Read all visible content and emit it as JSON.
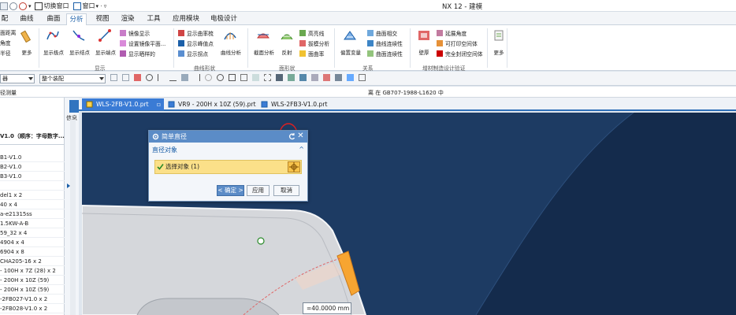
{
  "quick_access": {
    "switch_window": "切换窗口",
    "window": "窗口"
  },
  "app": {
    "title": "NX 12 - 建模"
  },
  "ribbon_tabs": [
    "配",
    "曲线",
    "曲面",
    "分析",
    "视图",
    "渲染",
    "工具",
    "应用模块",
    "电极设计"
  ],
  "ribbon": {
    "g0_small": [
      "面距离",
      "角度",
      "半径"
    ],
    "g0_more": "更多",
    "g1_big": [
      "显示极点",
      "显示结点",
      "显示端点"
    ],
    "g1_small": [
      "镜像显示",
      "设置镜像平面...",
      "显示晒样的"
    ],
    "g1_label": "显示",
    "g2_small": [
      "显示曲率梳",
      "显示峰值点",
      "显示拐点"
    ],
    "g2_big": "曲线分析",
    "g2_label": "曲线形状",
    "g3_big": [
      "截面分析",
      "反射"
    ],
    "g3_small": [
      "高亮线",
      "拔模分析",
      "面曲率"
    ],
    "g3_label": "面形状",
    "g4_big": "偏置变量",
    "g4_small": [
      "曲面相交",
      "曲线连续性",
      "曲面连续性"
    ],
    "g4_label": "关系",
    "g5_big": "壁厚",
    "g5_small": [
      "延展角度",
      "可打印空间体",
      "完全封闭空间体"
    ],
    "g5_label": "增材制造设计验证",
    "g6_more": "更多"
  },
  "toolbar": {
    "filter_value": "器",
    "assembly_value": "整个装配"
  },
  "status": {
    "left_label": "径测量",
    "message": "离 在 GB707-1988-L1620 中"
  },
  "navigator": {
    "side_label": "信息",
    "column_header": "V1.0（顺序：字母数字...",
    "items": [
      "B1-V1.0",
      "B2-V1.0",
      "B3-V1.0",
      "",
      "del1 x 2",
      "40 x 4",
      "a-e21315ss",
      "1.5KW-A-B",
      "59_32 x 4",
      "4904 x 4",
      "6904 x 8",
      "CHA205-16 x 2",
      "- 100H x 7Z (28) x 2",
      "- 200H x 10Z (59)",
      "- 200H x 10Z (59)",
      "-2FB027-V1.0 x 2",
      "-2FB028-V1.0 x 2"
    ]
  },
  "doc_tabs": [
    "WLS-2FB-V1.0.prt",
    "VR9 - 200H x 10Z (59).prt",
    "WLS-2FB3-V1.0.prt"
  ],
  "dialog": {
    "title": "简单直径",
    "section": "直径对象",
    "select_label": "选择对象 (1)",
    "ok": "< 确定 >",
    "apply": "应用",
    "cancel": "取消"
  },
  "measurement": "=40.0000 mm",
  "colors": {
    "accent": "#3a7bd5",
    "viewport_bg": "#1d3b63",
    "part_gray": "#d5d7db",
    "highlight": "#f7a531",
    "annotation_red": "#e02020"
  }
}
